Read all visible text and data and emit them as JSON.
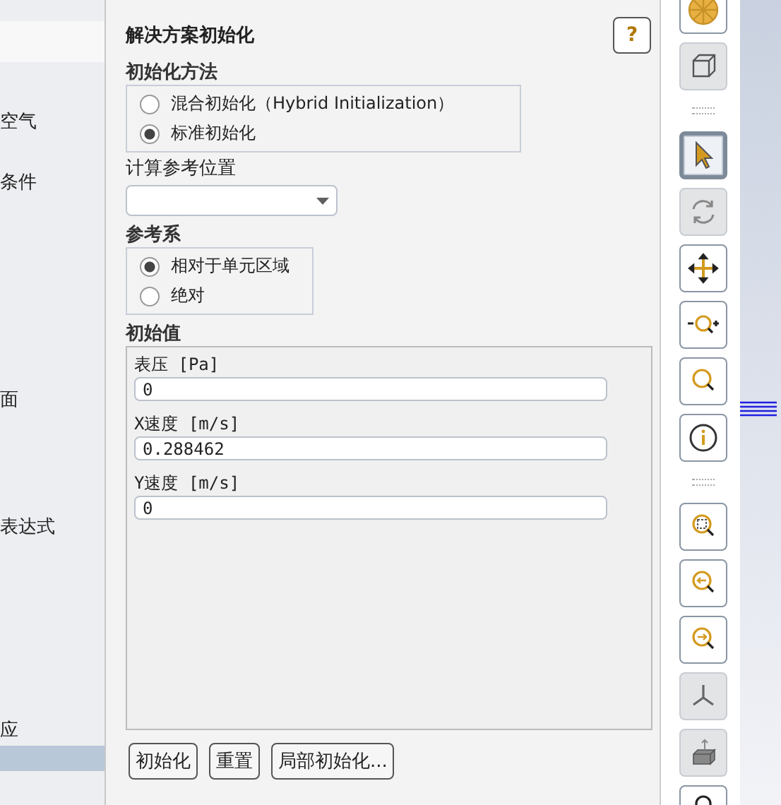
{
  "tree": {
    "items": [
      {
        "label": "空气",
        "selected": false
      },
      {
        "label": "条件",
        "selected": false
      },
      {
        "label": "面",
        "selected": false
      },
      {
        "label": "表达式",
        "selected": false
      },
      {
        "label": "应",
        "selected": false
      },
      {
        "selected": true
      }
    ]
  },
  "panel": {
    "title": "解决方案初始化",
    "help": "?",
    "method": {
      "label": "初始化方法",
      "options": [
        {
          "label": "混合初始化（Hybrid Initialization）",
          "selected": false
        },
        {
          "label": "标准初始化",
          "selected": true
        }
      ]
    },
    "reference_location": {
      "label": "计算参考位置"
    },
    "reference_frame": {
      "label": "参考系",
      "options": [
        {
          "label": "相对于单元区域",
          "selected": true
        },
        {
          "label": "绝对",
          "selected": false
        }
      ]
    },
    "initial_values": {
      "label": "初始值",
      "fields": [
        {
          "label": "表压 [Pa]",
          "value": "0"
        },
        {
          "label": "X速度 [m/s]",
          "value": "0.288462"
        },
        {
          "label": "Y速度 [m/s]",
          "value": "0"
        }
      ]
    },
    "buttons": [
      "初始化",
      "重置",
      "局部初始化..."
    ]
  },
  "toolbar": {
    "tools": [
      {
        "kind": "mesh",
        "selected": false,
        "disabled": false
      },
      {
        "kind": "box",
        "selected": false,
        "disabled": true
      },
      {
        "kind": "separator"
      },
      {
        "kind": "pointer",
        "selected": true,
        "disabled": false
      },
      {
        "kind": "rotate",
        "selected": false,
        "disabled": true
      },
      {
        "kind": "pan",
        "selected": false,
        "disabled": false
      },
      {
        "kind": "zoom-in-out",
        "selected": false,
        "disabled": false
      },
      {
        "kind": "zoom",
        "selected": false,
        "disabled": false
      },
      {
        "kind": "info",
        "selected": false,
        "disabled": false
      },
      {
        "kind": "separator"
      },
      {
        "kind": "zoom-box",
        "selected": false,
        "disabled": false
      },
      {
        "kind": "zoom-back",
        "selected": false,
        "disabled": false
      },
      {
        "kind": "zoom-forward",
        "selected": false,
        "disabled": false
      },
      {
        "kind": "axes",
        "selected": false,
        "disabled": true
      },
      {
        "kind": "extrude",
        "selected": false,
        "disabled": true
      },
      {
        "kind": "lock",
        "selected": false,
        "disabled": false
      }
    ]
  }
}
